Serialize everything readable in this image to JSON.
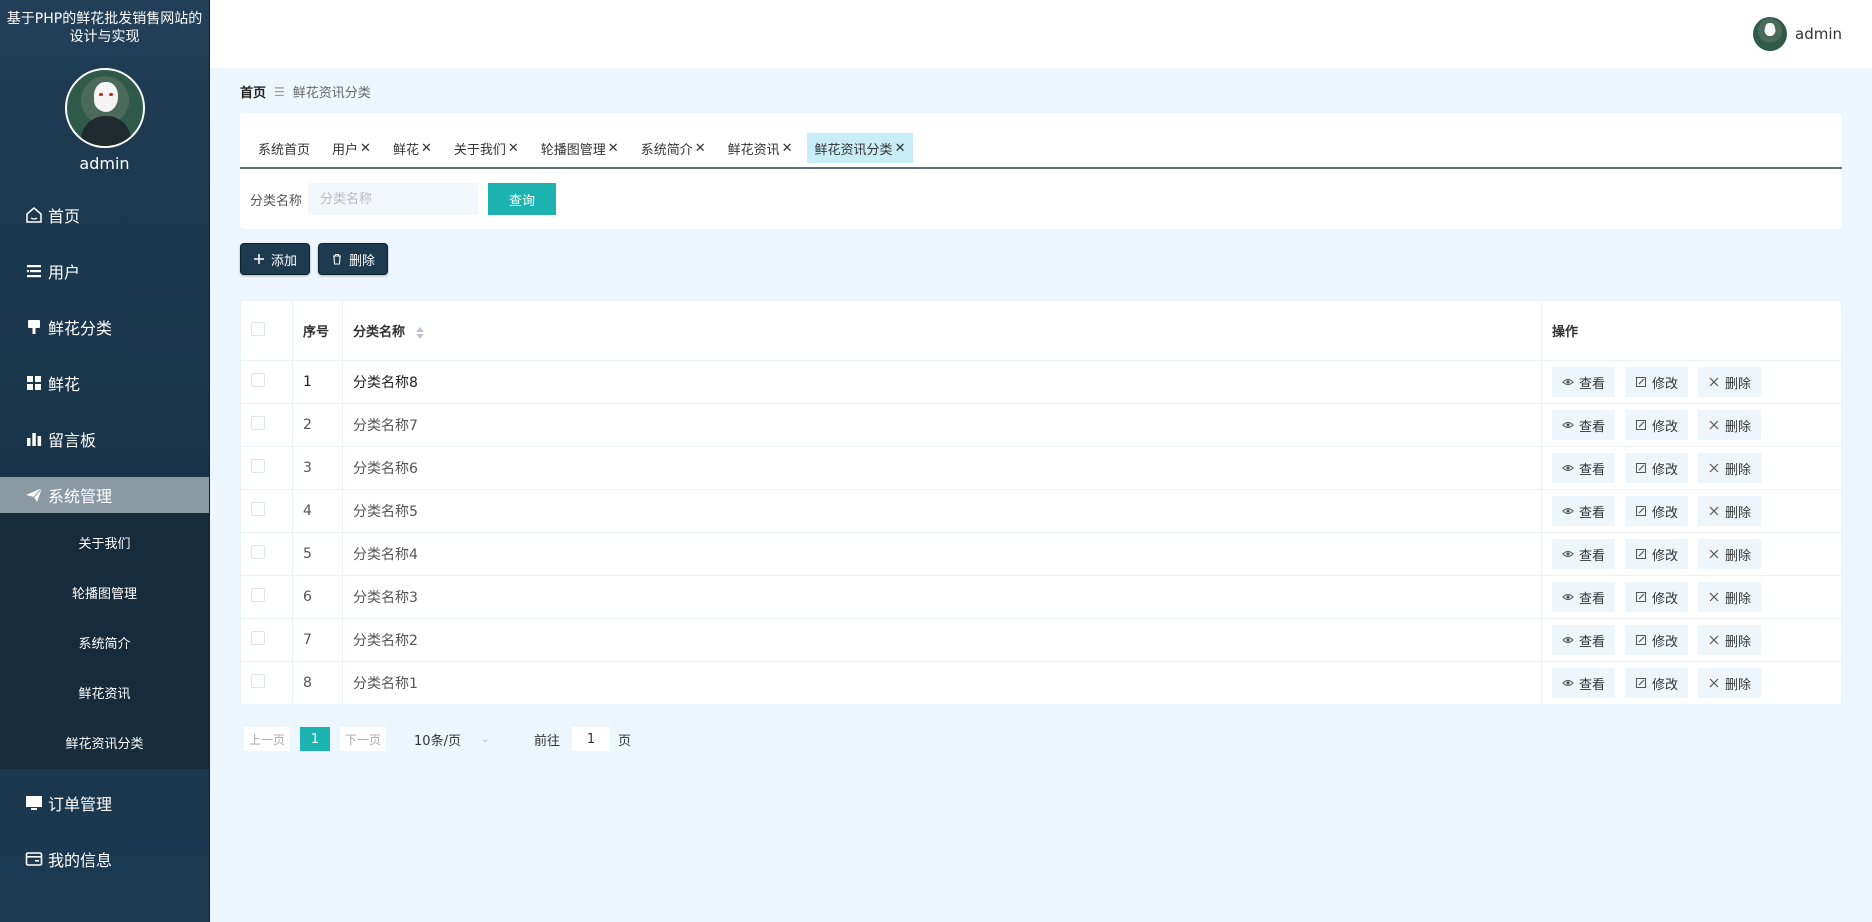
{
  "sidebar": {
    "title": "基于PHP的鲜花批发销售网站的设计与实现",
    "username": "admin",
    "menu": [
      {
        "label": "首页",
        "icon": "home-icon"
      },
      {
        "label": "用户",
        "icon": "list-icon"
      },
      {
        "label": "鲜花分类",
        "icon": "brush-icon"
      },
      {
        "label": "鲜花",
        "icon": "grid-icon"
      },
      {
        "label": "留言板",
        "icon": "bar-chart-icon"
      },
      {
        "label": "系统管理",
        "icon": "paper-plane-icon"
      }
    ],
    "submenu": [
      "关于我们",
      "轮播图管理",
      "系统简介",
      "鲜花资讯",
      "鲜花资讯分类"
    ],
    "menu_after": [
      {
        "label": "订单管理",
        "icon": "monitor-icon"
      },
      {
        "label": "我的信息",
        "icon": "id-card-icon"
      }
    ]
  },
  "topbar": {
    "username": "admin"
  },
  "breadcrumb": {
    "home": "首页",
    "current": "鲜花资讯分类"
  },
  "tabs": [
    {
      "label": "系统首页",
      "closable": false
    },
    {
      "label": "用户",
      "closable": true
    },
    {
      "label": "鲜花",
      "closable": true
    },
    {
      "label": "关于我们",
      "closable": true
    },
    {
      "label": "轮播图管理",
      "closable": true
    },
    {
      "label": "系统简介",
      "closable": true
    },
    {
      "label": "鲜花资讯",
      "closable": true
    },
    {
      "label": "鲜花资讯分类",
      "closable": true,
      "active": true
    }
  ],
  "search": {
    "label": "分类名称",
    "placeholder": "分类名称",
    "button": "查询"
  },
  "actions": {
    "add": "添加",
    "delete": "删除"
  },
  "table": {
    "headers": {
      "index": "序号",
      "name": "分类名称",
      "ops": "操作"
    },
    "rows": [
      {
        "index": "1",
        "name": "分类名称8"
      },
      {
        "index": "2",
        "name": "分类名称7"
      },
      {
        "index": "3",
        "name": "分类名称6"
      },
      {
        "index": "4",
        "name": "分类名称5"
      },
      {
        "index": "5",
        "name": "分类名称4"
      },
      {
        "index": "6",
        "name": "分类名称3"
      },
      {
        "index": "7",
        "name": "分类名称2"
      },
      {
        "index": "8",
        "name": "分类名称1"
      }
    ],
    "ops": {
      "view": "查看",
      "edit": "修改",
      "delete": "删除"
    }
  },
  "pagination": {
    "prev": "上一页",
    "current": "1",
    "next": "下一页",
    "page_size": "10条/页",
    "goto_label": "前往",
    "goto_value": "1",
    "goto_suffix": "页"
  },
  "colors": {
    "accent": "#1db3b0",
    "sidebar": "#1f3d55",
    "active_tab": "#c8edf7"
  }
}
